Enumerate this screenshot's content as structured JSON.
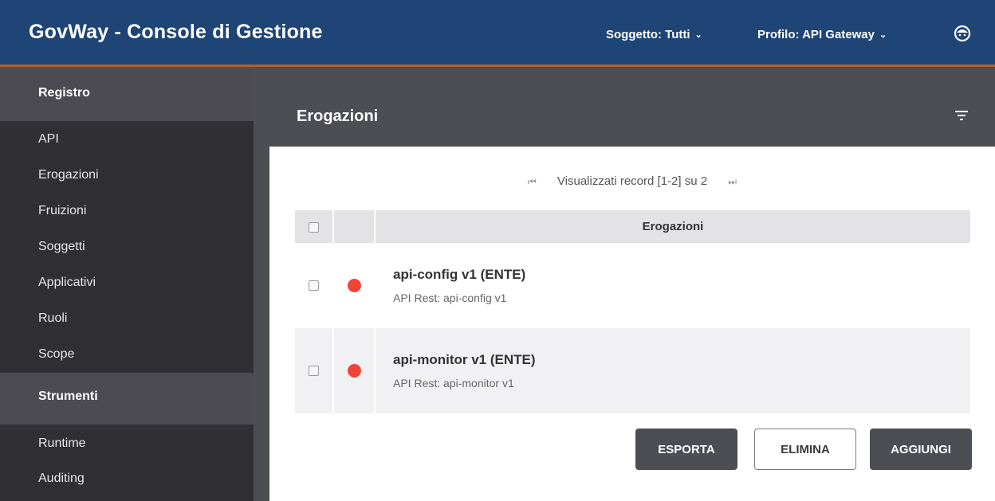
{
  "header": {
    "title": "GovWay - Console di Gestione",
    "soggetto": "Soggetto: Tutti",
    "profilo": "Profilo: API Gateway",
    "chevron": "⌄",
    "user_icon": "user-face-icon",
    "colors": {
      "bar": "#1f4476",
      "accent_line": "#b65e2a"
    }
  },
  "sidebar": {
    "sections": [
      {
        "label": "Registro",
        "items": [
          "API",
          "Erogazioni",
          "Fruizioni",
          "Soggetti",
          "Applicativi",
          "Ruoli",
          "Scope"
        ]
      },
      {
        "label": "Strumenti",
        "items": [
          "Runtime",
          "Auditing"
        ]
      }
    ]
  },
  "main": {
    "title": "Erogazioni",
    "filter_icon": "filter-icon",
    "pager": {
      "first": "⏮",
      "text": "Visualizzati record [1-2] su 2",
      "last": "⏭"
    },
    "table": {
      "column_header": "Erogazioni",
      "rows": [
        {
          "title": "api-config v1 (ENTE)",
          "subtitle": "API Rest: api-config v1",
          "status_color": "#f04436"
        },
        {
          "title": "api-monitor v1 (ENTE)",
          "subtitle": "API Rest: api-monitor v1",
          "status_color": "#f04436"
        }
      ]
    },
    "buttons": {
      "export": "ESPORTA",
      "delete": "ELIMINA",
      "add": "AGGIUNGI"
    }
  }
}
